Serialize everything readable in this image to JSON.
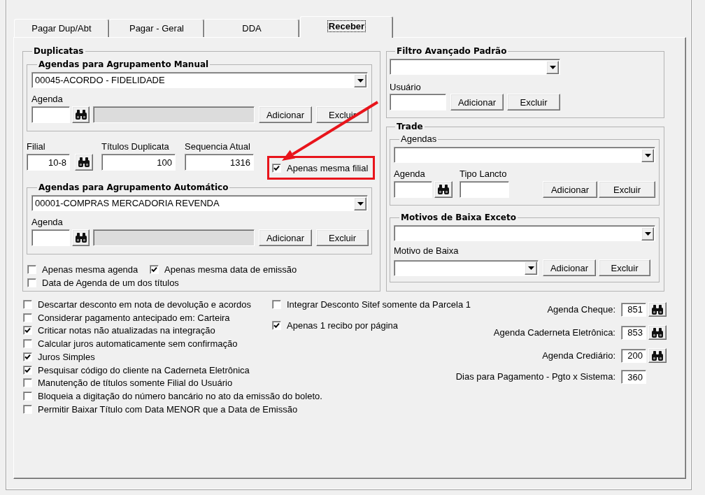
{
  "tabs": [
    {
      "label": "Pagar Dup/Abt",
      "selected": false
    },
    {
      "label": "Pagar - Geral",
      "selected": false
    },
    {
      "label": "DDA",
      "selected": false
    },
    {
      "label": "Receber",
      "selected": true
    }
  ],
  "duplicatas": {
    "title": "Duplicatas",
    "manual": {
      "title": "Agendas para Agrupamento Manual",
      "dropdown": {
        "value": "00045-ACORDO - FIDELIDADE"
      },
      "agenda_label": "Agenda",
      "description_field": {
        "disabled": true
      },
      "buttons": [
        "Adicionar",
        "Excluir"
      ]
    },
    "fields": [
      {
        "label": "Filial",
        "value": "10-8",
        "lookup": true
      },
      {
        "label": "Títulos Duplicata",
        "value": "100",
        "lookup": false
      },
      {
        "label": "Sequencia Atual",
        "value": "1316",
        "lookup": false
      }
    ],
    "branch_check": {
      "label": "Apenas mesma filial",
      "checked": true,
      "highlighted": true
    },
    "automatic": {
      "title": "Agendas para Agrupamento Automático",
      "dropdown": {
        "value": "00001-COMPRAS MERCADORIA REVENDA"
      },
      "agenda_label": "Agenda",
      "description_field": {
        "disabled": true
      },
      "buttons": [
        "Adicionar",
        "Excluir"
      ]
    },
    "options": [
      {
        "label": "Apenas mesma agenda",
        "checked": false
      },
      {
        "label": "Apenas mesma data de emissão",
        "checked": true
      },
      {
        "label": "Data de Agenda de um dos títulos",
        "checked": false
      }
    ]
  },
  "filtro": {
    "title": "Filtro Avançado Padrão",
    "user_label": "Usuário",
    "buttons": [
      "Adicionar",
      "Excluir"
    ]
  },
  "trade": {
    "title": "Trade",
    "agendas": {
      "title": "Agendas",
      "agenda_label": "Agenda",
      "type_label": "Tipo Lancto",
      "buttons": [
        "Adicionar",
        "Excluir"
      ]
    },
    "motivos": {
      "title": "Motivos de Baixa Exceto",
      "reason_label": "Motivo de Baixa",
      "buttons": [
        "Adicionar",
        "Excluir"
      ]
    }
  },
  "options": [
    {
      "label": "Descartar desconto em nota de devolução e acordos",
      "checked": false
    },
    {
      "label": "Considerar pagamento antecipado em: Carteira",
      "checked": false
    },
    {
      "label": "Criticar notas não atualizadas na integração",
      "checked": true
    },
    {
      "label": "Calcular juros automaticamente sem confirmação",
      "checked": false
    },
    {
      "label": "Juros Simples",
      "checked": true
    },
    {
      "label": "Pesquisar código do cliente na Caderneta Eletrônica",
      "checked": true
    },
    {
      "label": "Manutenção de títulos somente Filial do Usuário",
      "checked": false
    },
    {
      "label": "Bloqueia a digitação do número bancário no ato da emissão do boleto.",
      "checked": false
    },
    {
      "label": "Permitir Baixar Título com Data MENOR que a Data de Emissão",
      "checked": false
    }
  ],
  "side_options": [
    {
      "label": "Integrar Desconto Sitef somente da Parcela 1",
      "checked": false
    },
    {
      "label": "Apenas 1 recibo por página",
      "checked": true
    }
  ],
  "agenda_settings": [
    {
      "label": "Agenda Cheque:",
      "value": "851",
      "lookup": true
    },
    {
      "label": "Agenda Caderneta Eletrônica:",
      "value": "853",
      "lookup": true
    },
    {
      "label": "Agenda Crediário:",
      "value": "200",
      "lookup": true
    },
    {
      "label": "Dias para Pagamento - Pgto x Sistema:",
      "value": "360",
      "lookup": false
    }
  ]
}
